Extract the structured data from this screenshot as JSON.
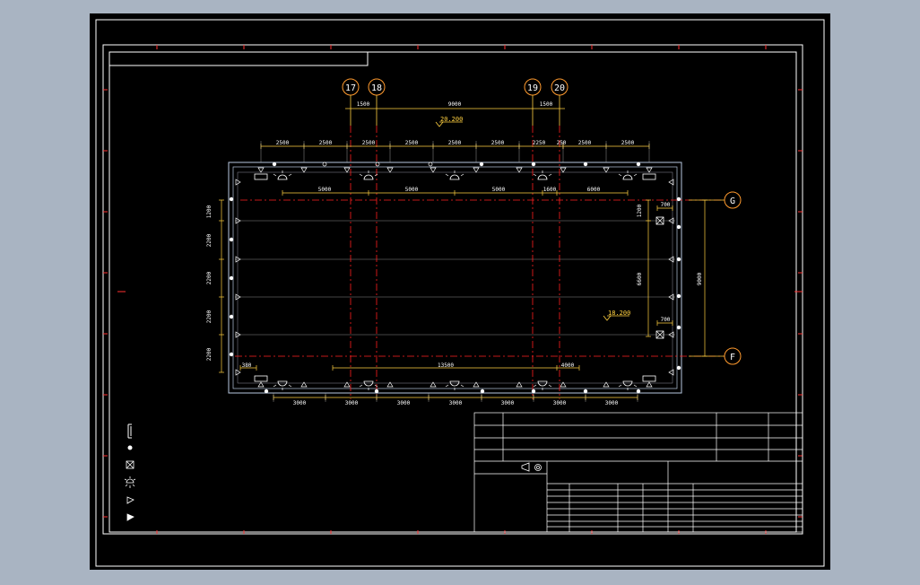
{
  "title_strip": "",
  "axes": {
    "vertical": [
      "17",
      "18",
      "19",
      "20"
    ],
    "horizontal": [
      "G",
      "F"
    ]
  },
  "top_axis_dims": [
    "1500",
    "9000",
    "1500"
  ],
  "elevations": {
    "top": "20.200",
    "inner": "18.200"
  },
  "top_spacing_dims": [
    "2500",
    "2500",
    "2500",
    "2500",
    "2500",
    "2500",
    "2250",
    "250",
    "2500",
    "2500"
  ],
  "top_inner_dims": [
    "5000",
    "5000",
    "5000",
    "1600",
    "6000"
  ],
  "left_dims": [
    "1200",
    "2200",
    "2200",
    "2200",
    "2200"
  ],
  "right_dims": {
    "span": "6600",
    "overall": "9000",
    "top_offset": "1200",
    "box_offset_top": "700",
    "box_offset_bottom": "700"
  },
  "bottom_inner_dims": {
    "left_offset": "380",
    "middle": "13500",
    "right": "4000"
  },
  "bottom_dims": [
    "3000",
    "3000",
    "3000",
    "3000",
    "3000",
    "3000",
    "3000"
  ],
  "center_mark": "",
  "legend": {
    "title": "",
    "items": [
      {
        "icon": "bracket-icon",
        "label": ""
      },
      {
        "icon": "dot-icon",
        "label": ""
      },
      {
        "icon": "crossbox-icon",
        "label": ""
      },
      {
        "icon": "floodlight-icon",
        "label": ""
      },
      {
        "icon": "triangle-icon",
        "label": ""
      },
      {
        "icon": "arrow-icon",
        "label": ""
      }
    ]
  },
  "title_block": {
    "company": "",
    "project": "",
    "label_left": "",
    "scale": "",
    "sheet": ""
  },
  "colors": {
    "frame": "#ffffff",
    "axis_line": "#ff2020",
    "dimension": "#ffd040",
    "grid_line": "#8a8a8a",
    "background": "#000000",
    "surround": "#a9b4c2"
  }
}
